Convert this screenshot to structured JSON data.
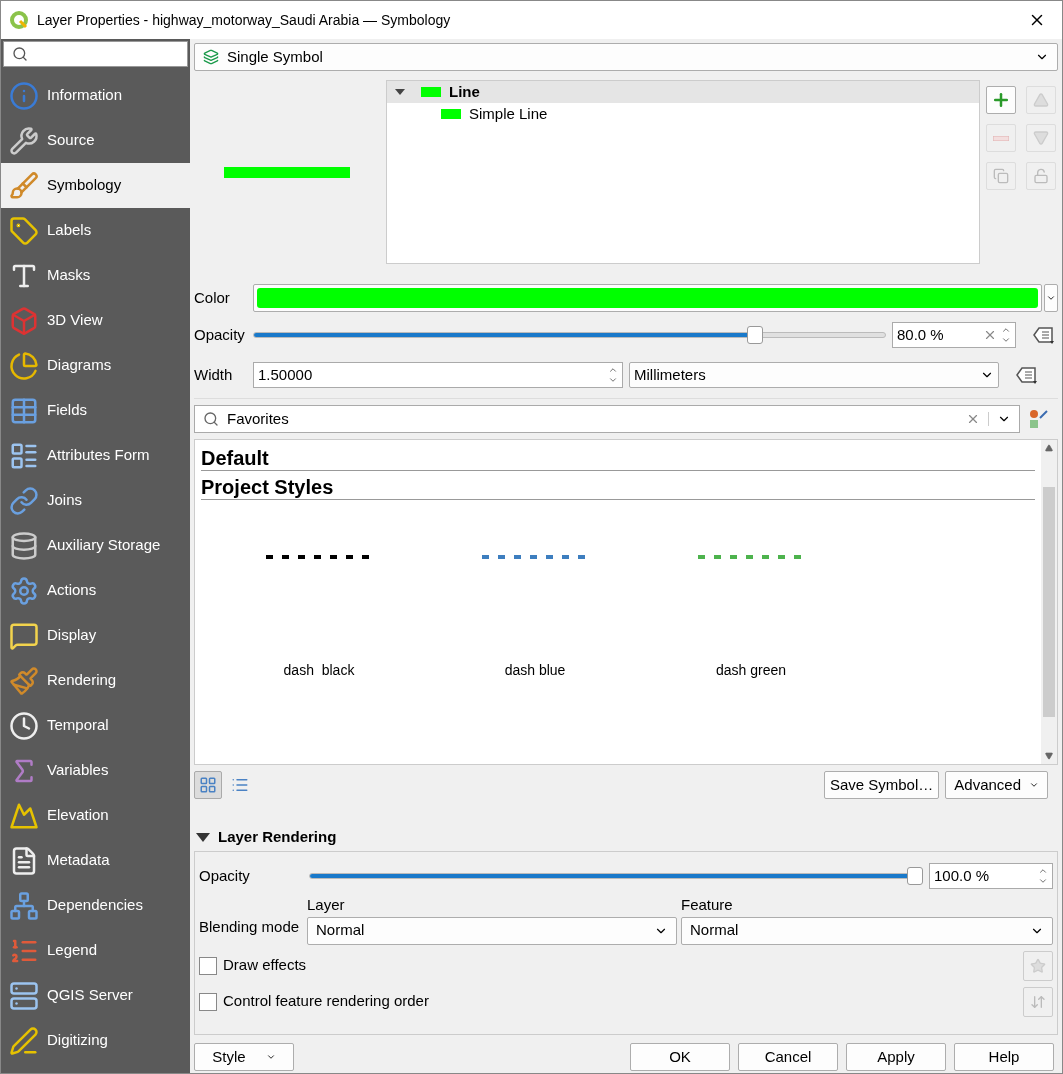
{
  "window": {
    "title": "Layer Properties - highway_motorway_Saudi Arabia — Symbology"
  },
  "sidebar": {
    "items": [
      {
        "label": "Information",
        "selected": false
      },
      {
        "label": "Source",
        "selected": false
      },
      {
        "label": "Symbology",
        "selected": true
      },
      {
        "label": "Labels",
        "selected": false
      },
      {
        "label": "Masks",
        "selected": false
      },
      {
        "label": "3D View",
        "selected": false
      },
      {
        "label": "Diagrams",
        "selected": false
      },
      {
        "label": "Fields",
        "selected": false
      },
      {
        "label": "Attributes Form",
        "selected": false
      },
      {
        "label": "Joins",
        "selected": false
      },
      {
        "label": "Auxiliary Storage",
        "selected": false
      },
      {
        "label": "Actions",
        "selected": false
      },
      {
        "label": "Display",
        "selected": false
      },
      {
        "label": "Rendering",
        "selected": false
      },
      {
        "label": "Temporal",
        "selected": false
      },
      {
        "label": "Variables",
        "selected": false
      },
      {
        "label": "Elevation",
        "selected": false
      },
      {
        "label": "Metadata",
        "selected": false
      },
      {
        "label": "Dependencies",
        "selected": false
      },
      {
        "label": "Legend",
        "selected": false
      },
      {
        "label": "QGIS Server",
        "selected": false
      },
      {
        "label": "Digitizing",
        "selected": false
      }
    ]
  },
  "renderer": "Single Symbol",
  "symbol_tree": [
    {
      "label": "Line",
      "selected": true,
      "expanded": true,
      "children": [
        {
          "label": "Simple Line",
          "selected": false
        }
      ]
    }
  ],
  "color": {
    "label": "Color",
    "color": "#00ff00"
  },
  "opacity": {
    "label": "Opacity",
    "level": 0.8,
    "reading": "80.0 %"
  },
  "width": {
    "label": "Width",
    "value": "1.50000",
    "unit": "Millimeters"
  },
  "library": {
    "search": "Favorites",
    "groups": [
      "Default",
      "Project Styles"
    ],
    "symbols": [
      {
        "name": "dash  black",
        "color": "#000000"
      },
      {
        "name": "dash blue",
        "color": "#3d7ebf"
      },
      {
        "name": "dash green",
        "color": "#4db34d"
      }
    ],
    "views": [
      {
        "kind": "icons",
        "selected": true
      },
      {
        "kind": "list",
        "selected": false
      }
    ],
    "buttons": [
      "Save Symbol…",
      "Advanced"
    ]
  },
  "layer_rendering": {
    "title": "Layer Rendering",
    "expanded": true,
    "opacity": {
      "label": "Opacity",
      "level": 1.0,
      "reading": "100.0 %"
    },
    "blending": {
      "label": "Blending mode",
      "layer_label": "Layer",
      "layer_value": "Normal",
      "feature_label": "Feature",
      "feature_value": "Normal"
    },
    "checkboxes": [
      {
        "label": "Draw effects",
        "checked": false
      },
      {
        "label": "Control feature rendering order",
        "checked": false
      }
    ]
  },
  "footer": {
    "style": "Style",
    "buttons": [
      "OK",
      "Cancel",
      "Apply",
      "Help"
    ]
  }
}
